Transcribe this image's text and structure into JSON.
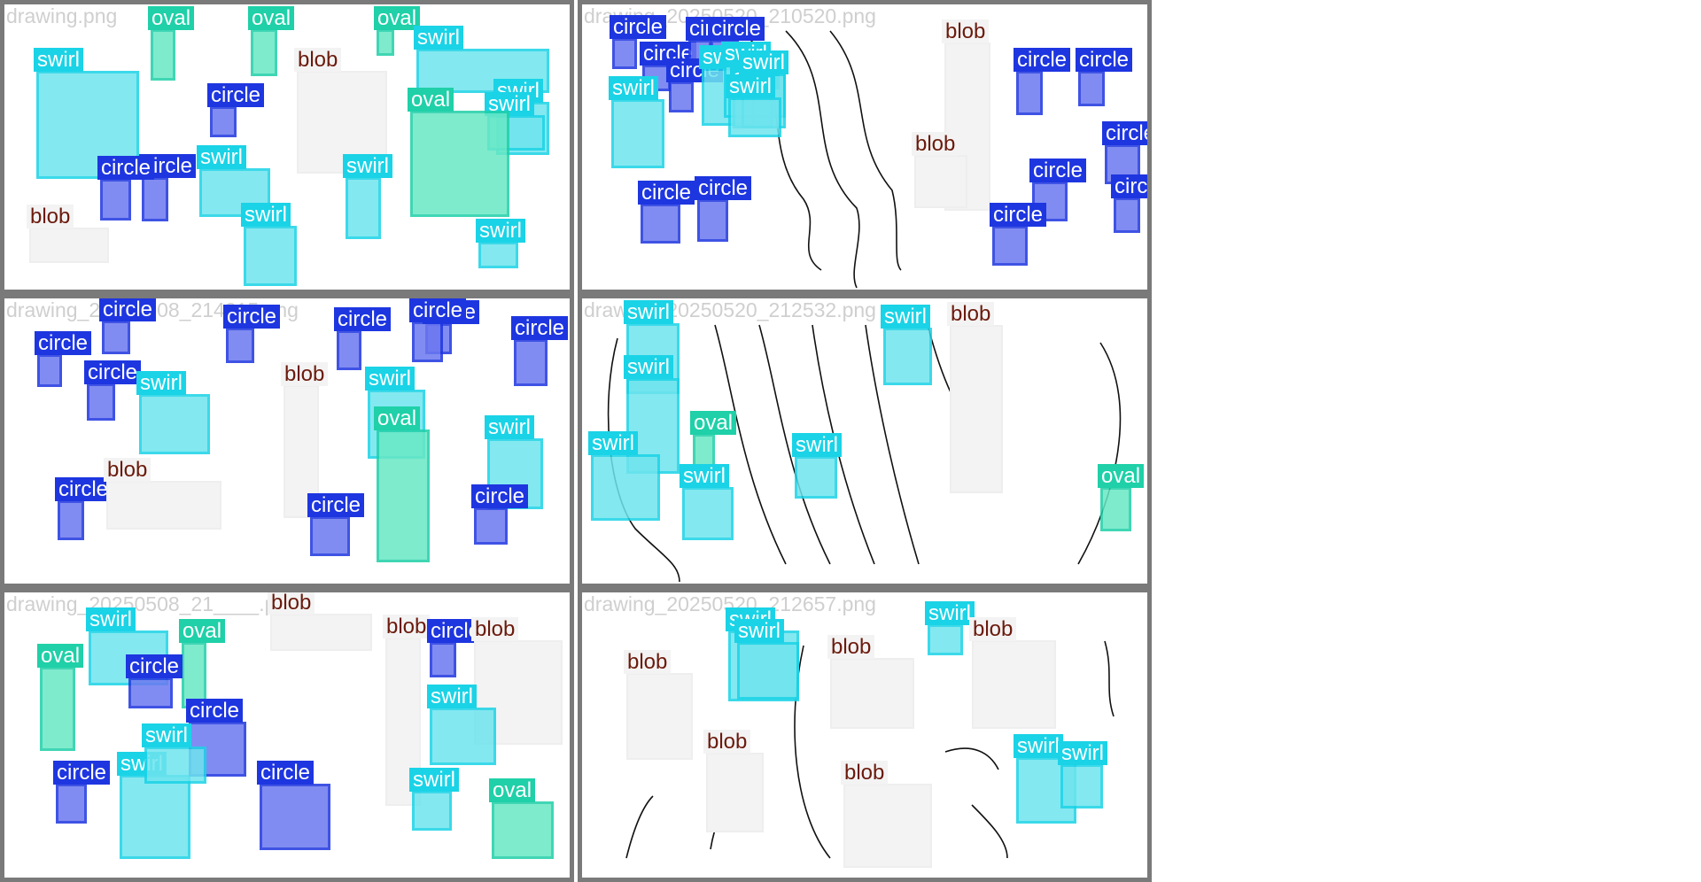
{
  "colors": {
    "circle": "#1e36e0",
    "circle_fill": "#6c78f0",
    "swirl": "#1ad3e6",
    "swirl_fill": "#6fe4ee",
    "oval": "#1fd0a8",
    "oval_fill": "#68e8c4",
    "blob": "#eeeeee",
    "blob_fill": "#f3f3f3",
    "blob_text": "#6b1a0c",
    "panel_border": "#7a7a7a",
    "filename_text": "#cfcfcf"
  },
  "panels": [
    {
      "filename": "drawing.png",
      "detections": [
        {
          "label": "oval"
        },
        {
          "label": "oval"
        },
        {
          "label": "oval"
        },
        {
          "label": "swirl"
        },
        {
          "label": "blob"
        },
        {
          "label": "circle"
        },
        {
          "label": "circle"
        },
        {
          "label": "swirl"
        },
        {
          "label": "swirl"
        },
        {
          "label": "swirl"
        },
        {
          "label": "swirl"
        },
        {
          "label": "swirl"
        },
        {
          "label": "oval"
        },
        {
          "label": "circle"
        },
        {
          "label": "blob"
        },
        {
          "label": "swirl"
        },
        {
          "label": "swirl"
        },
        {
          "label": "oval"
        }
      ]
    },
    {
      "filename": "drawing_20250520_210520.png",
      "detections": [
        {
          "label": "circle"
        },
        {
          "label": "circle"
        },
        {
          "label": "circle"
        },
        {
          "label": "circle"
        },
        {
          "label": "swirl"
        },
        {
          "label": "circle"
        },
        {
          "label": "swirl"
        },
        {
          "label": "swirl"
        },
        {
          "label": "swirl"
        },
        {
          "label": "swirl"
        },
        {
          "label": "swirl"
        },
        {
          "label": "circle"
        },
        {
          "label": "circle"
        },
        {
          "label": "blob"
        },
        {
          "label": "blob"
        },
        {
          "label": "circle"
        },
        {
          "label": "circle"
        },
        {
          "label": "circle"
        },
        {
          "label": "circle"
        },
        {
          "label": "circle"
        },
        {
          "label": "circle"
        }
      ]
    },
    {
      "filename": "drawing_20250508_214215.png",
      "detections": [
        {
          "label": "circle"
        },
        {
          "label": "circle"
        },
        {
          "label": "circle"
        },
        {
          "label": "circle"
        },
        {
          "label": "circle"
        },
        {
          "label": "circle"
        },
        {
          "label": "circle"
        },
        {
          "label": "swirl"
        },
        {
          "label": "circle"
        },
        {
          "label": "blob"
        },
        {
          "label": "swirl"
        },
        {
          "label": "oval"
        },
        {
          "label": "blob"
        },
        {
          "label": "circle"
        },
        {
          "label": "swirl"
        },
        {
          "label": "circle"
        },
        {
          "label": "circle"
        }
      ]
    },
    {
      "filename": "drawing_20250520_212532.png",
      "detections": [
        {
          "label": "swirl"
        },
        {
          "label": "swirl"
        },
        {
          "label": "swirl"
        },
        {
          "label": "blob"
        },
        {
          "label": "oval"
        },
        {
          "label": "swirl"
        },
        {
          "label": "swirl"
        },
        {
          "label": "swirl"
        },
        {
          "label": "oval"
        }
      ]
    },
    {
      "filename": "drawing_20250508_21____.png",
      "detections": [
        {
          "label": "swirl"
        },
        {
          "label": "oval"
        },
        {
          "label": "oval"
        },
        {
          "label": "blob"
        },
        {
          "label": "blob"
        },
        {
          "label": "circle"
        },
        {
          "label": "blob"
        },
        {
          "label": "swirl"
        },
        {
          "label": "circle"
        },
        {
          "label": "swirl"
        },
        {
          "label": "circle"
        },
        {
          "label": "swirl"
        },
        {
          "label": "circle"
        },
        {
          "label": "circle"
        },
        {
          "label": "swirl"
        },
        {
          "label": "oval"
        },
        {
          "label": "oval"
        },
        {
          "label": "swirl"
        }
      ]
    },
    {
      "filename": "drawing_20250520_212657.png",
      "detections": [
        {
          "label": "swirl"
        },
        {
          "label": "swirl"
        },
        {
          "label": "swirl"
        },
        {
          "label": "blob"
        },
        {
          "label": "blob"
        },
        {
          "label": "blob"
        },
        {
          "label": "blob"
        },
        {
          "label": "blob"
        },
        {
          "label": "swirl"
        },
        {
          "label": "swirl"
        }
      ]
    }
  ]
}
